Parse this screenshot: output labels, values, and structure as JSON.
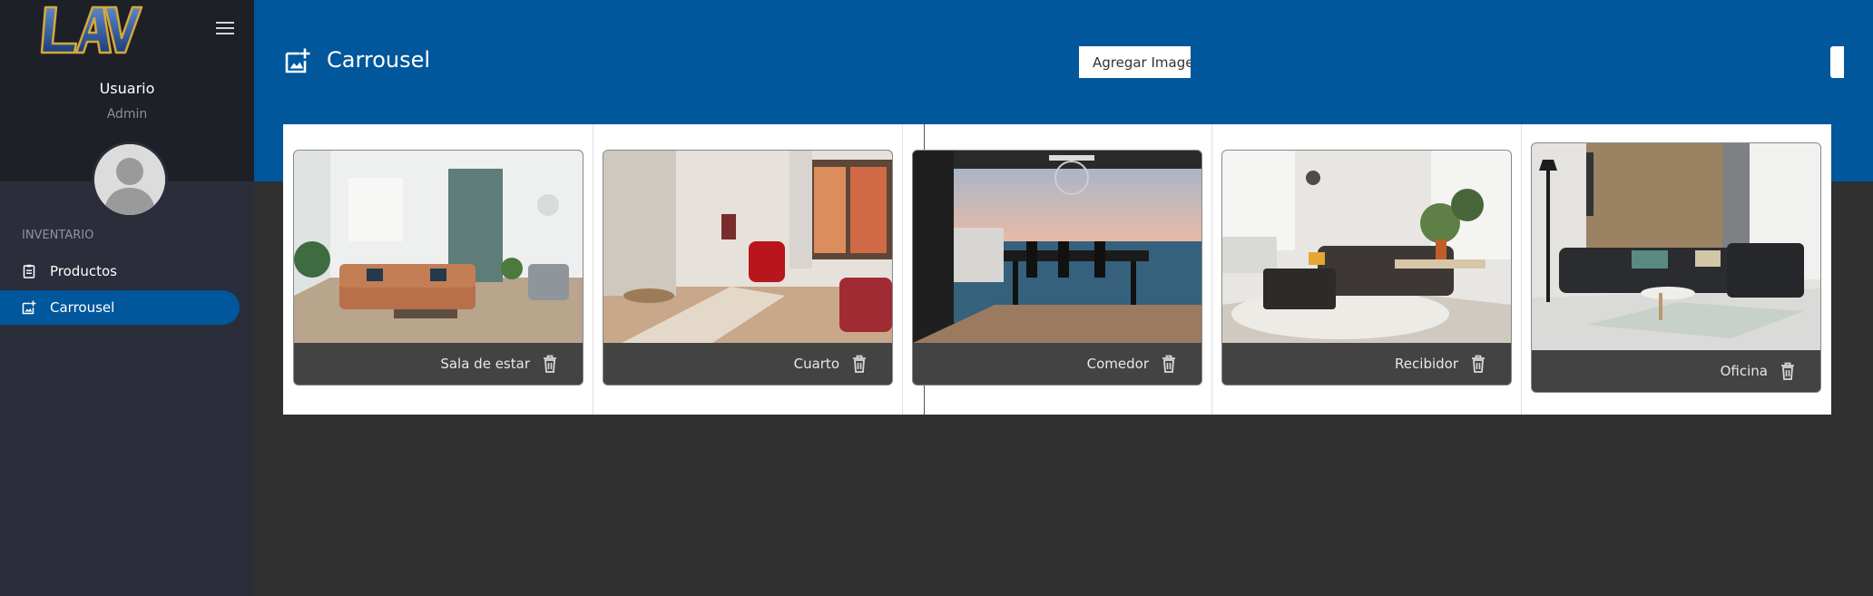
{
  "sidebar": {
    "logo_text": "LAV",
    "user_name": "Usuario",
    "user_role": "Admin",
    "section_label": "INVENTARIO",
    "items": [
      {
        "label": "Productos",
        "icon": "clipboard-icon",
        "active": false
      },
      {
        "label": "Carrousel",
        "icon": "add-photo-icon",
        "active": true
      }
    ]
  },
  "header": {
    "title": "Carrousel",
    "add_button_label": "Agregar Imagen"
  },
  "carousel": {
    "slides": [
      {
        "caption": "Sala de estar",
        "image": "living-room-photo"
      },
      {
        "caption": "Cuarto",
        "image": "bedroom-photo"
      },
      {
        "caption": "Comedor",
        "image": "dining-room-photo"
      },
      {
        "caption": "Recibidor",
        "image": "lounge-photo"
      },
      {
        "caption": "Oficina",
        "image": "office-photo"
      }
    ]
  },
  "colors": {
    "primary": "#01579b",
    "sidebar": "#2b2d3a",
    "sidebar_top": "#1e2028",
    "background": "#303030",
    "caption_bar": "#434343"
  }
}
